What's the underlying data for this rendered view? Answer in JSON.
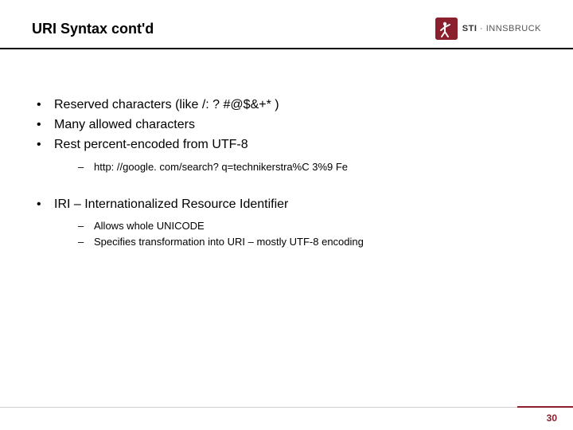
{
  "header": {
    "title": "URI Syntax cont'd",
    "logo": {
      "brand": "STI",
      "sep": " · ",
      "city": "INNSBRUCK"
    }
  },
  "bullets": {
    "b1": "Reserved characters (like /: ? #@$&+* )",
    "b2": "Many allowed characters",
    "b3": "Rest percent-encoded from UTF-8",
    "b3_sub1": "http: //google. com/search? q=technikerstra%C 3%9 Fe",
    "b4": "IRI – Internationalized Resource Identifier",
    "b4_sub1": "Allows whole UNICODE",
    "b4_sub2": "Specifies transformation into URI – mostly UTF-8 encoding"
  },
  "footer": {
    "page_number": "30"
  },
  "colors": {
    "accent": "#8a1f2d"
  }
}
